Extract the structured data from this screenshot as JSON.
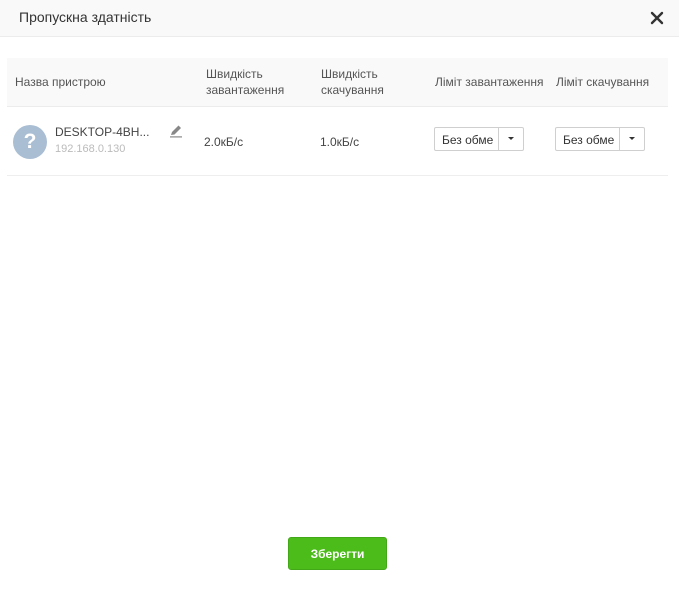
{
  "dialog": {
    "title": "Пропускна здатність"
  },
  "table": {
    "headers": {
      "device_name": "Назва пристрою",
      "upload_speed": "Швидкість завантаження",
      "upload_speed_line1": "Швидкість",
      "upload_speed_line2": "завантаження",
      "download_speed_line1": "Швидкість",
      "download_speed_line2": "скачування",
      "upload_limit": "Ліміт завантаження",
      "download_limit": "Ліміт скачування"
    },
    "rows": [
      {
        "avatar_glyph": "?",
        "device_name": "DESKTOP-4BH...",
        "ip": "192.168.0.130",
        "upload_speed": "2.0кБ/с",
        "download_speed": "1.0кБ/с",
        "upload_limit": "Без обме",
        "download_limit": "Без обме"
      }
    ]
  },
  "footer": {
    "save_label": "Зберегти"
  },
  "icons": {
    "close": "close-icon",
    "edit": "pencil-icon",
    "unknown_device": "question-mark-icon",
    "dropdown": "caret-down-icon"
  },
  "colors": {
    "accent": "#4cbc1b",
    "avatar": "#a9bdd3",
    "header_bg": "#f9f9f9"
  }
}
